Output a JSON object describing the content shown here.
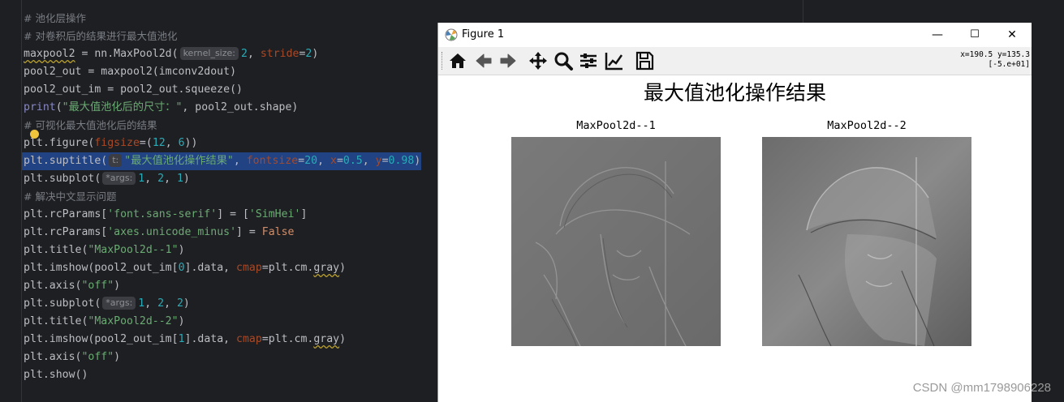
{
  "editor": {
    "lines": [
      {
        "kind": "comment",
        "text": "# 池化层操作"
      },
      {
        "kind": "comment",
        "text": "# 对卷积后的结果进行最大值池化"
      },
      {
        "kind": "code",
        "parts": [
          [
            "squig",
            "maxpool2"
          ],
          [
            "p",
            " = nn.MaxPool2d("
          ],
          [
            "hint",
            "kernel_size:"
          ],
          [
            "num",
            "2"
          ],
          [
            "p",
            ", "
          ],
          [
            "param",
            "stride"
          ],
          [
            "p",
            "="
          ],
          [
            "num",
            "2"
          ],
          [
            "p",
            ")"
          ]
        ]
      },
      {
        "kind": "code",
        "parts": [
          [
            "p",
            "pool2_out = maxpool2(imconv2dout)"
          ]
        ]
      },
      {
        "kind": "code",
        "parts": [
          [
            "p",
            "pool2_out_im = pool2_out.squeeze()"
          ]
        ]
      },
      {
        "kind": "code",
        "parts": [
          [
            "bi",
            "print"
          ],
          [
            "p",
            "("
          ],
          [
            "str",
            "\"最大值池化后的尺寸：\""
          ],
          [
            "p",
            ", pool2_out.shape)"
          ]
        ]
      },
      {
        "kind": "comment",
        "text": "# 可视化最大值池化后的结果"
      },
      {
        "kind": "code",
        "bulb": true,
        "parts": [
          [
            "p",
            "plt.figure("
          ],
          [
            "param",
            "figsize"
          ],
          [
            "p",
            "=("
          ],
          [
            "num",
            "12"
          ],
          [
            "p",
            ", "
          ],
          [
            "num",
            "6"
          ],
          [
            "p",
            "))"
          ]
        ]
      },
      {
        "kind": "code",
        "selected": true,
        "parts": [
          [
            "p",
            "plt.suptitle("
          ],
          [
            "hint",
            "t:"
          ],
          [
            "str",
            "\"最大值池化操作结果\""
          ],
          [
            "p",
            ", "
          ],
          [
            "param",
            "fontsize"
          ],
          [
            "p",
            "="
          ],
          [
            "num",
            "20"
          ],
          [
            "p",
            ", "
          ],
          [
            "param",
            "x"
          ],
          [
            "p",
            "="
          ],
          [
            "num",
            "0.5"
          ],
          [
            "p",
            ", "
          ],
          [
            "param",
            "y"
          ],
          [
            "p",
            "="
          ],
          [
            "num",
            "0.98"
          ],
          [
            "p",
            ")"
          ]
        ]
      },
      {
        "kind": "code",
        "parts": [
          [
            "p",
            "plt.subplot("
          ],
          [
            "hint",
            "*args:"
          ],
          [
            "num",
            "1"
          ],
          [
            "p",
            ", "
          ],
          [
            "num",
            "2"
          ],
          [
            "p",
            ", "
          ],
          [
            "num",
            "1"
          ],
          [
            "p",
            ")"
          ]
        ]
      },
      {
        "kind": "comment",
        "text": "# 解决中文显示问题"
      },
      {
        "kind": "code",
        "parts": [
          [
            "p",
            "plt.rcParams["
          ],
          [
            "str",
            "'font.sans-serif'"
          ],
          [
            "p",
            "] = ["
          ],
          [
            "str",
            "'SimHei'"
          ],
          [
            "p",
            "]"
          ]
        ]
      },
      {
        "kind": "code",
        "parts": [
          [
            "p",
            "plt.rcParams["
          ],
          [
            "str",
            "'axes.unicode_minus'"
          ],
          [
            "p",
            "] = "
          ],
          [
            "kw",
            "False"
          ]
        ]
      },
      {
        "kind": "code",
        "parts": [
          [
            "p",
            "plt.title("
          ],
          [
            "str",
            "\"MaxPool2d--1\""
          ],
          [
            "p",
            ")"
          ]
        ]
      },
      {
        "kind": "code",
        "parts": [
          [
            "p",
            "plt.imshow(pool2_out_im["
          ],
          [
            "num",
            "0"
          ],
          [
            "p",
            "].data, "
          ],
          [
            "param",
            "cmap"
          ],
          [
            "p",
            "=plt.cm."
          ],
          [
            "squig",
            "gray"
          ],
          [
            "p",
            ")"
          ]
        ]
      },
      {
        "kind": "code",
        "parts": [
          [
            "p",
            "plt.axis("
          ],
          [
            "str",
            "\"off\""
          ],
          [
            "p",
            ")"
          ]
        ]
      },
      {
        "kind": "code",
        "parts": [
          [
            "p",
            "plt.subplot("
          ],
          [
            "hint",
            "*args:"
          ],
          [
            "num",
            "1"
          ],
          [
            "p",
            ", "
          ],
          [
            "num",
            "2"
          ],
          [
            "p",
            ", "
          ],
          [
            "num",
            "2"
          ],
          [
            "p",
            ")"
          ]
        ]
      },
      {
        "kind": "code",
        "parts": [
          [
            "p",
            "plt.title("
          ],
          [
            "str",
            "\"MaxPool2d--2\""
          ],
          [
            "p",
            ")"
          ]
        ]
      },
      {
        "kind": "code",
        "parts": [
          [
            "p",
            "plt.imshow(pool2_out_im["
          ],
          [
            "num",
            "1"
          ],
          [
            "p",
            "].data, "
          ],
          [
            "param",
            "cmap"
          ],
          [
            "p",
            "=plt.cm."
          ],
          [
            "squig",
            "gray"
          ],
          [
            "p",
            ")"
          ]
        ]
      },
      {
        "kind": "code",
        "parts": [
          [
            "p",
            "plt.axis("
          ],
          [
            "str",
            "\"off\""
          ],
          [
            "p",
            ")"
          ]
        ]
      },
      {
        "kind": "code",
        "parts": [
          [
            "p",
            "plt.show()"
          ]
        ]
      }
    ]
  },
  "figure_window": {
    "title": "Figure 1",
    "minimize_glyph": "—",
    "maximize_glyph": "☐",
    "close_glyph": "✕",
    "toolbar_tools": [
      "home-icon",
      "back-arrow-icon",
      "forward-arrow-icon",
      "pan-icon",
      "zoom-icon",
      "subplots-config-icon",
      "edit-axis-icon",
      "save-icon"
    ],
    "coords_line1": "x=190.5 y=135.3",
    "coords_line2": "[-5.e+01]",
    "suptitle": "最大值池化操作结果",
    "subplot1_title": "MaxPool2d--1",
    "subplot2_title": "MaxPool2d--2"
  },
  "watermark": "CSDN @mm1798906228"
}
